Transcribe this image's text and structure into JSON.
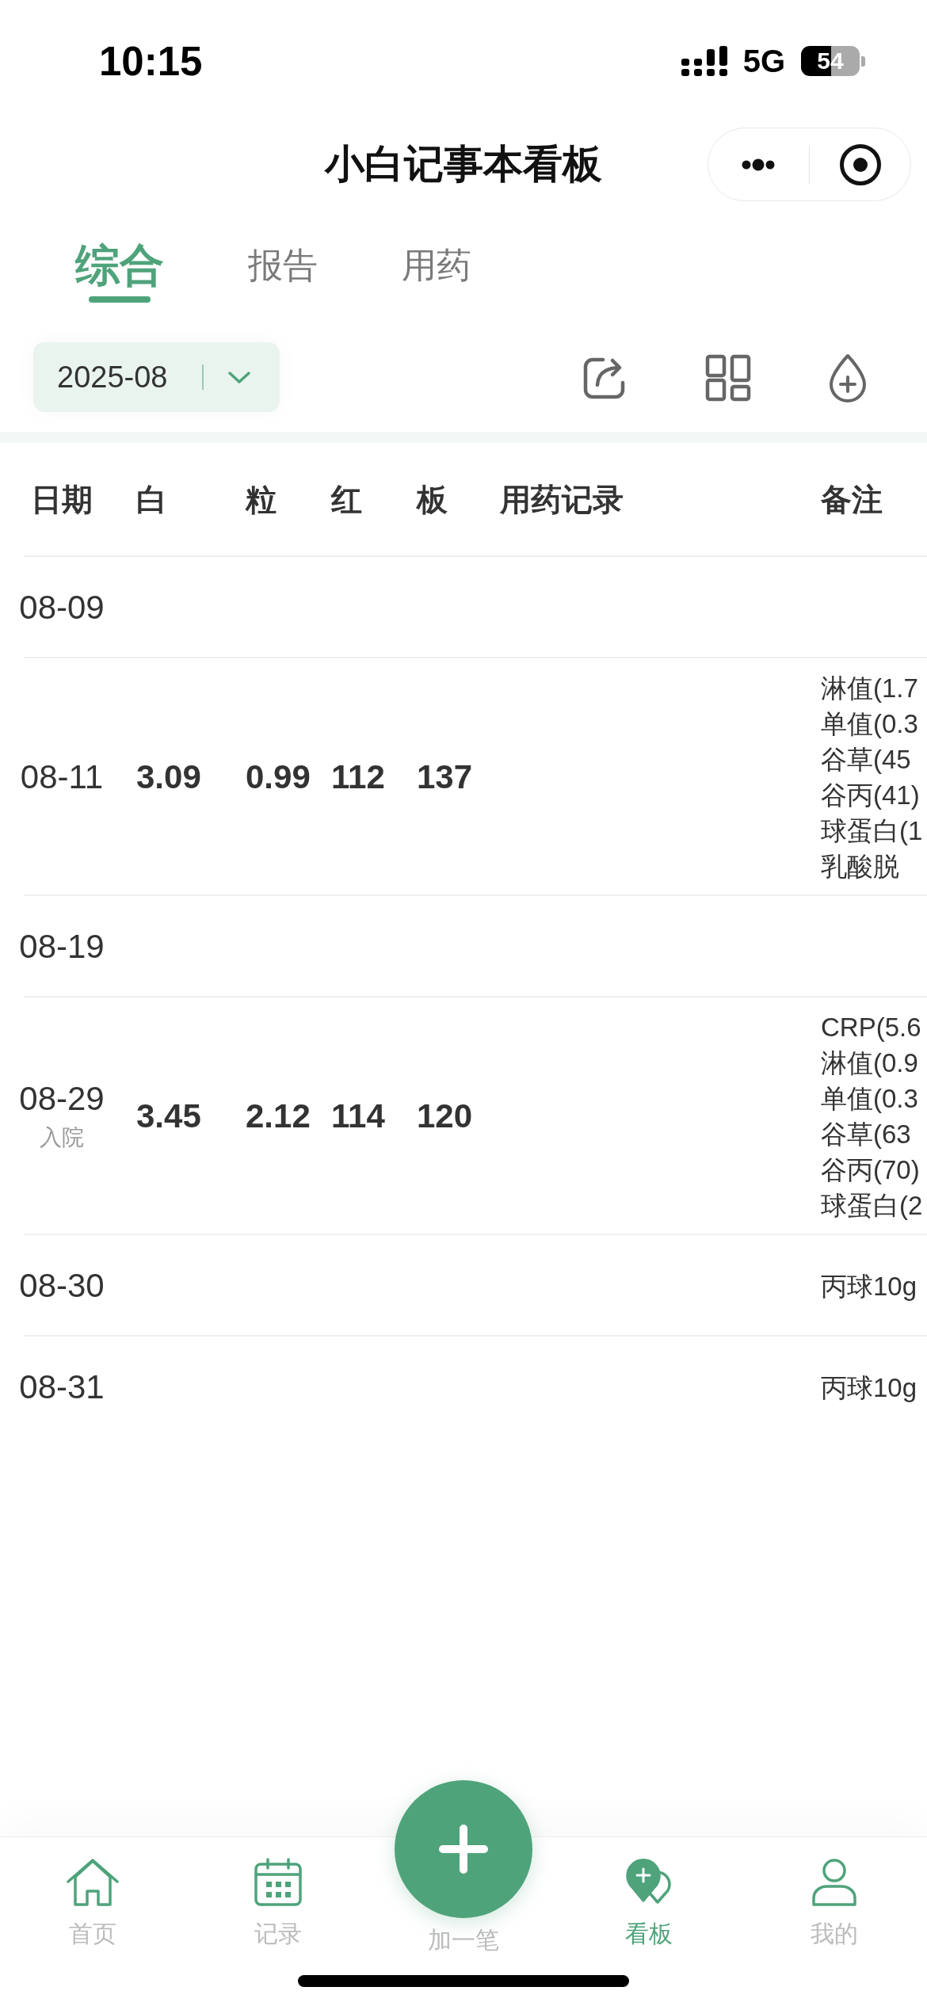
{
  "status_bar": {
    "time": "10:15",
    "network": "5G",
    "battery": "54"
  },
  "nav_bar": {
    "title": "小白记事本看板"
  },
  "tabs": [
    {
      "label": "综合",
      "selected": true
    },
    {
      "label": "报告",
      "selected": false
    },
    {
      "label": "用药",
      "selected": false
    }
  ],
  "toolbar": {
    "month": "2025-08"
  },
  "table": {
    "columns": [
      "日期",
      "白",
      "粒",
      "红",
      "板",
      "用药记录",
      "备注"
    ],
    "rows": [
      {
        "date": "08-09"
      },
      {
        "date": "08-11",
        "values": [
          "3.09",
          "0.99",
          "112",
          "137"
        ],
        "notes": [
          "淋值(1.7",
          "单值(0.3",
          "谷草(45",
          "谷丙(41)",
          "球蛋白(1",
          "乳酸脱"
        ]
      },
      {
        "date": "08-19"
      },
      {
        "date": "08-29",
        "tag": "入院",
        "values": [
          "3.45",
          "2.12",
          "114",
          "120"
        ],
        "notes": [
          "CRP(5.6",
          "淋值(0.9",
          "单值(0.3",
          "谷草(63",
          "谷丙(70)",
          "球蛋白(2"
        ]
      },
      {
        "date": "08-30",
        "notes": [
          "丙球10g"
        ]
      },
      {
        "date": "08-31",
        "notes": [
          "丙球10g"
        ]
      }
    ]
  },
  "bottom_nav": {
    "items": [
      {
        "label": "首页",
        "kind": "tab",
        "selected": false
      },
      {
        "label": "记录",
        "kind": "tab",
        "selected": false
      },
      {
        "label": "加一笔",
        "kind": "add",
        "selected": false
      },
      {
        "label": "看板",
        "kind": "tab",
        "selected": true
      },
      {
        "label": "我的",
        "kind": "tab",
        "selected": false
      }
    ]
  }
}
